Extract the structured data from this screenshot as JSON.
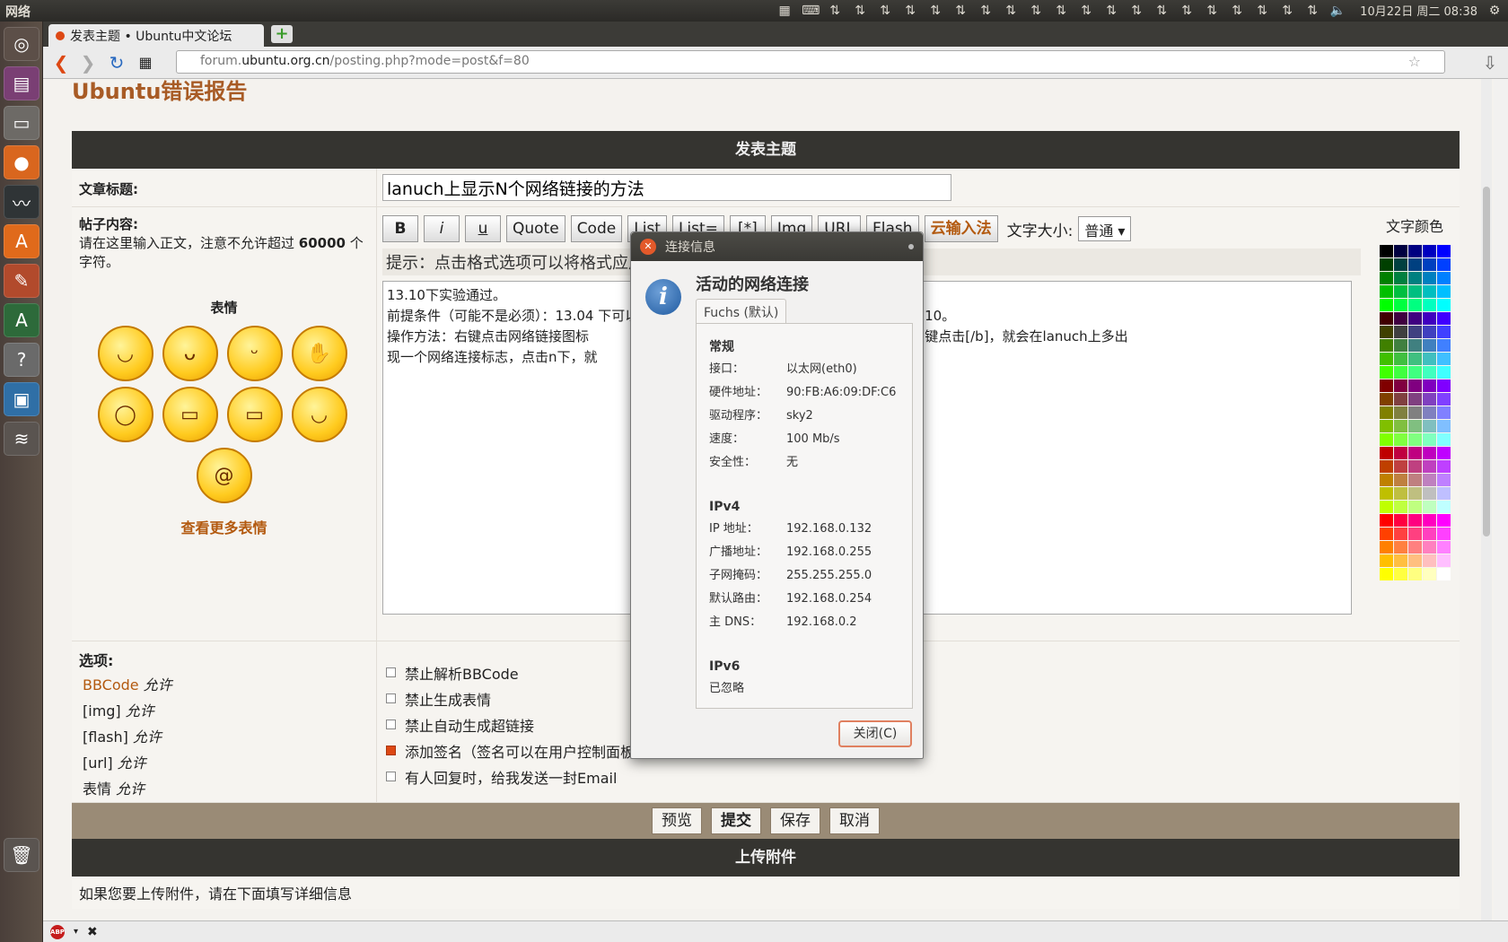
{
  "top_panel": {
    "app_name": "网络",
    "clock": "10月22日 周二  08:38"
  },
  "browser": {
    "tab_title": "发表主题 • Ubuntu中文论坛",
    "new_tab": "+",
    "url_prefix": "forum.",
    "url_domain": "ubuntu.org.cn",
    "url_path": "/posting.php?mode=post&f=80"
  },
  "page": {
    "site_title": "Ubuntu错误报告",
    "section_title": "发表主题",
    "subject_label": "文章标题:",
    "subject_value": "lanuch上显示N个网络链接的方法",
    "content_label": "帖子内容:",
    "content_note": "请在这里输入正文，注意不允许超过 60000 个字符。",
    "content_note_pre": "请在这里输入正文，注意不允许超过 ",
    "content_note_num": "60000",
    "content_note_post": " 个字符。",
    "smilies_label": "表情",
    "more_smilies": "查看更多表情",
    "bbcode_buttons": [
      "B",
      "i",
      "u",
      "Quote",
      "Code",
      "List",
      "List=",
      "[*]",
      "Img",
      "URL",
      "Flash"
    ],
    "ime_button": "云输入法",
    "font_size_label": "文字大小:",
    "font_size_value": "普通",
    "hint": "提示：点击格式选项可以将格式应用到选择的文字上",
    "content_lines": [
      "13.10下实验通过。",
      "前提条件（可能不是必须）：13.04 下可以用 tweak 调整界面，但这个tweak暂不支持13.10。",
      "操作方法：右键点击网络链接图标                              在左侧面板的网络连接图标上[b]中键点击[/b]，就会在lanuch上多出",
      "现一个网络连接标志，点击n下，就"
    ],
    "color_label": "文字颜色",
    "options_label": "选项:",
    "permissions": [
      {
        "name": "BBCode",
        "state": "允许"
      },
      {
        "name": "[img]",
        "state": "允许"
      },
      {
        "name": "[flash]",
        "state": "允许"
      },
      {
        "name": "[url]",
        "state": "允许"
      },
      {
        "name": "表情",
        "state": "允许"
      }
    ],
    "options": [
      {
        "label": "禁止解析BBCode",
        "checked": false
      },
      {
        "label": "禁止生成表情",
        "checked": false
      },
      {
        "label": "禁止自动生成超链接",
        "checked": false
      },
      {
        "label": "添加签名（签名可以在用户控制面板修改）",
        "checked": true
      },
      {
        "label": "有人回复时，给我发送一封Email",
        "checked": false
      }
    ],
    "buttons": {
      "preview": "预览",
      "submit": "提交",
      "save": "保存",
      "cancel": "取消"
    },
    "upload_title": "上传附件",
    "upload_note": "如果您要上传附件，请在下面填写详细信息"
  },
  "dialog": {
    "title": "连接信息",
    "heading": "活动的网络连接",
    "tab": "Fuchs (默认)",
    "general_label": "常规",
    "general": [
      {
        "k": "接口：",
        "v": "以太网(eth0)"
      },
      {
        "k": "硬件地址：",
        "v": "90:FB:A6:09:DF:C6"
      },
      {
        "k": "驱动程序：",
        "v": "sky2"
      },
      {
        "k": "速度：",
        "v": "100 Mb/s"
      },
      {
        "k": "安全性：",
        "v": "无"
      }
    ],
    "ipv4_label": "IPv4",
    "ipv4": [
      {
        "k": "IP 地址：",
        "v": "192.168.0.132"
      },
      {
        "k": "广播地址：",
        "v": "192.168.0.255"
      },
      {
        "k": "子网掩码：",
        "v": "255.255.255.0"
      },
      {
        "k": "默认路由：",
        "v": "192.168.0.254"
      },
      {
        "k": "主 DNS：",
        "v": "192.168.0.2"
      }
    ],
    "ipv6_label": "IPv6",
    "ipv6_value": "已忽略",
    "close_button": "关闭(C)"
  },
  "colors": {
    "accent": "#dd4814",
    "link": "#b35a10",
    "header_bg": "#353430",
    "submit_bar": "#9a8b76"
  }
}
